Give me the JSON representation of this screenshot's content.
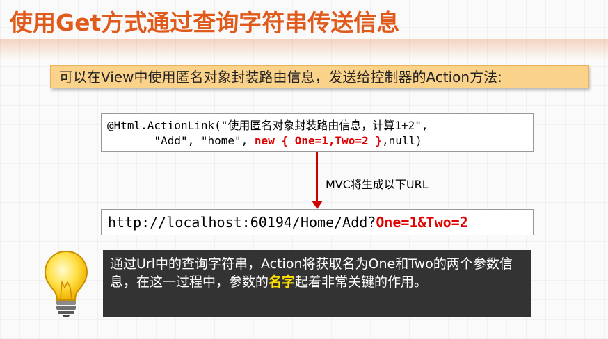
{
  "slide": {
    "title": "使用Get方式通过查询字符串传送信息",
    "intro": "可以在View中使用匿名对象封装路由信息，发送给控制器的Action方法:",
    "code": {
      "line1": "@Html.ActionLink(\"使用匿名对象封装路由信息，计算1+2\",",
      "line2_prefix": "       \"Add\", \"home\", ",
      "line2_highlight": "new { One=1,Two=2 }",
      "line2_suffix": ",null)"
    },
    "arrow_label": "MVC将生成以下URL",
    "url": {
      "prefix": "http://localhost:60194/Home/Add?",
      "highlight": "One=1&Two=2"
    },
    "note": {
      "part1": "通过Url中的查询字符串，Action将获取名为One和Two的两个参数信息，在这一过程中，参数的",
      "highlight": "名字",
      "part2": "起着非常关键的作用。"
    }
  },
  "colors": {
    "title": "#e05a1c",
    "intro_bg": "#fbd28a",
    "code_highlight": "#e00000",
    "arrow": "#d00000",
    "note_bg": "#333333",
    "note_highlight": "#ffe000"
  },
  "icons": {
    "tip": "lightbulb-icon"
  }
}
